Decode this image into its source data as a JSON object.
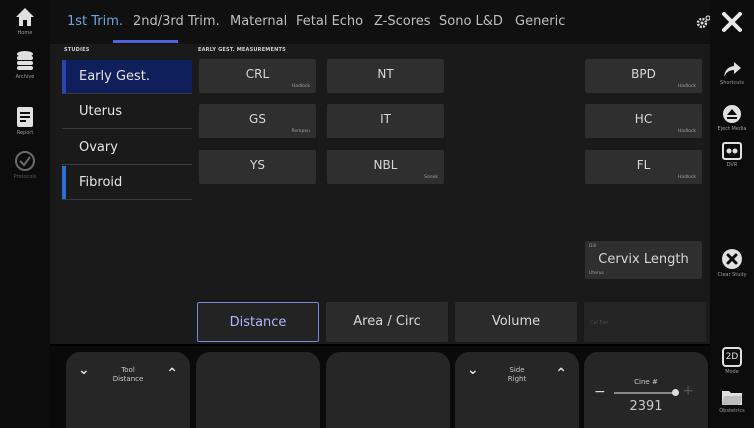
{
  "left_rail": {
    "items": [
      {
        "label": "Home",
        "icon": "home-icon"
      },
      {
        "label": "Archive",
        "icon": "database-icon"
      },
      {
        "label": "Report",
        "icon": "report-icon"
      },
      {
        "label": "Protocols",
        "icon": "check-circle-icon"
      }
    ]
  },
  "tabs": [
    "1st Trim.",
    "2nd/3rd Trim.",
    "Maternal",
    "Fetal Echo",
    "Z-Scores",
    "Sono L&D",
    "Generic"
  ],
  "active_tab": "1st Trim.",
  "studies": {
    "label": "STUDIES",
    "items": [
      {
        "name": "Early Gest.",
        "selected": true,
        "color": "#0f1f5c"
      },
      {
        "name": "Uterus",
        "selected": false,
        "color": "#2a6fd6"
      },
      {
        "name": "Ovary",
        "selected": false,
        "color": "#2a6fd6"
      },
      {
        "name": "Fibroid",
        "selected": false,
        "color": "#2a6fd6"
      }
    ]
  },
  "measurements": {
    "label": "EARLY GEST. MEASUREMENTS",
    "buttons": [
      {
        "name": "CRL",
        "sub": "Hadlock"
      },
      {
        "name": "NT",
        "sub": ""
      },
      {
        "name": "BPD",
        "sub": "Hadlock"
      },
      {
        "name": "GS",
        "sub": "Rempen"
      },
      {
        "name": "IT",
        "sub": ""
      },
      {
        "name": "HC",
        "sub": "Hadlock"
      },
      {
        "name": "YS",
        "sub": ""
      },
      {
        "name": "NBL",
        "sub": "Sonek"
      },
      {
        "name": "FL",
        "sub": "Hadlock"
      }
    ],
    "cervix": {
      "name": "Cervix Length",
      "pre": "Dill",
      "sub": "Uterus"
    }
  },
  "modes": {
    "buttons": [
      "Distance",
      "Area / Circ",
      "Volume",
      "Cal Fan"
    ],
    "selected": "Distance"
  },
  "knobs": {
    "tool": {
      "title": "Tool",
      "value": "Distance"
    },
    "side": {
      "title": "Side",
      "value": "Right"
    },
    "cine": {
      "title": "Cine #",
      "value": "2391",
      "minus": "−",
      "plus": "+"
    }
  },
  "right_rail": {
    "items": [
      {
        "label": "",
        "icon": "close-icon"
      },
      {
        "label": "Shortcuts",
        "icon": "share-arrow-icon"
      },
      {
        "label": "Eject Media",
        "icon": "eject-icon"
      },
      {
        "label": "DVR",
        "icon": "dvr-icon"
      },
      {
        "label": "Clear Study",
        "icon": "clear-x-icon"
      },
      {
        "label": "Mode",
        "icon": "mode-2d-icon",
        "text": "2D"
      },
      {
        "label": "Obstetrics",
        "icon": "folder-icon"
      }
    ]
  },
  "colors": {
    "accent": "#6aa7e0",
    "tab_underline": "#4d67d8",
    "selected_study": "#0f1f5c",
    "study_bar": "#2a6fd6"
  }
}
